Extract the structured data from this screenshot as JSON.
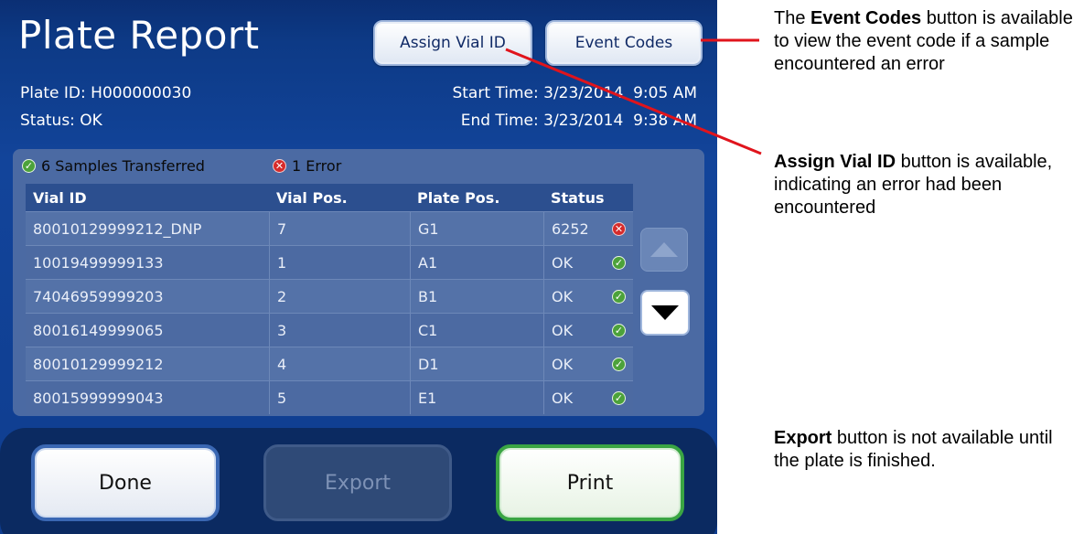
{
  "screen": {
    "title": "Plate Report",
    "buttons": {
      "assign_vial_id": "Assign Vial ID",
      "event_codes": "Event Codes"
    },
    "info": {
      "plate_id": "Plate ID: H000000030",
      "status": "Status: OK",
      "start_time": "Start Time: 3/23/2014  9:05 AM",
      "end_time": "End Time: 3/23/2014  9:38 AM"
    },
    "summary": {
      "transferred": "6 Samples Transferred",
      "errors": "1 Error"
    },
    "table": {
      "headers": [
        "Vial ID",
        "Vial Pos.",
        "Plate Pos.",
        "Status"
      ],
      "rows": [
        {
          "vial_id": "80010129999212_DNP",
          "vial_pos": "7",
          "plate_pos": "G1",
          "status": "6252",
          "icon": "error-icon"
        },
        {
          "vial_id": "10019499999133",
          "vial_pos": "1",
          "plate_pos": "A1",
          "status": "OK",
          "icon": "check-icon"
        },
        {
          "vial_id": "74046959999203",
          "vial_pos": "2",
          "plate_pos": "B1",
          "status": "OK",
          "icon": "check-icon"
        },
        {
          "vial_id": "80016149999065",
          "vial_pos": "3",
          "plate_pos": "C1",
          "status": "OK",
          "icon": "check-icon"
        },
        {
          "vial_id": "80010129999212",
          "vial_pos": "4",
          "plate_pos": "D1",
          "status": "OK",
          "icon": "check-icon"
        },
        {
          "vial_id": "80015999999043",
          "vial_pos": "5",
          "plate_pos": "E1",
          "status": "OK",
          "icon": "check-icon"
        }
      ]
    },
    "bottom_buttons": {
      "done": "Done",
      "export": "Export",
      "print": "Print"
    }
  },
  "annotations": {
    "event_codes": {
      "pre": "The ",
      "bold": "Event Codes",
      "post": " button is available to view the event code if a sample encountered an error"
    },
    "assign_vial_id": {
      "bold": "Assign Vial ID",
      "post": " button is available, indicating an error had been encountered"
    },
    "export": {
      "bold": "Export",
      "post": " button is not available until the plate is finished."
    }
  },
  "colors": {
    "leader_line": "#e0141c",
    "screen_bg": "#0f3d8f",
    "ok": "#4ca23a",
    "error": "#d62b2b"
  }
}
